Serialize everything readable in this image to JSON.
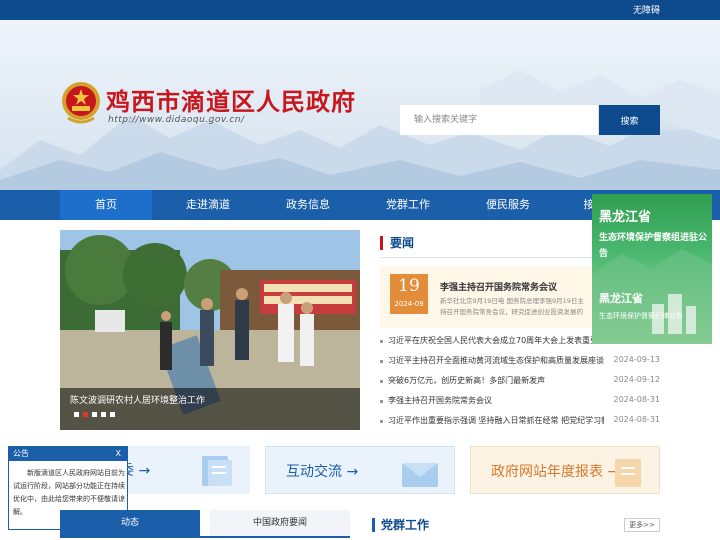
{
  "topbar": {
    "accessibility": "无障碍"
  },
  "header": {
    "title": "鸡西市滴道区人民政府",
    "url": "http://www.didaoqu.gov.cn/"
  },
  "search": {
    "placeholder": "输入搜索关键字",
    "button": "搜索"
  },
  "nav": {
    "items": [
      {
        "label": "首页"
      },
      {
        "label": "走进滴道"
      },
      {
        "label": "政务信息"
      },
      {
        "label": "党群工作"
      },
      {
        "label": "便民服务"
      },
      {
        "label": "接"
      }
    ]
  },
  "slider": {
    "caption": "陈文波调研农村人居环境整治工作"
  },
  "news": {
    "title": "要闻",
    "headline": {
      "day": "19",
      "ym": "2024-09",
      "title": "李强主持召开国务院常务会议",
      "summary": "新华社北京9月19日电  国务院总理李强9月19日主持召开国务院常务会议，研究促进创业投资发展的有关举措..."
    },
    "items": [
      {
        "text": "习近平在庆祝全国人民代表大会成立70周年大会上发表重要讲话",
        "date": ""
      },
      {
        "text": "习近平主持召开全面推动黄河流域生态保护和高质量发展座谈会",
        "date": "2024-09-13"
      },
      {
        "text": "突破6万亿元，创历史新高！多部门最新发声",
        "date": "2024-09-12"
      },
      {
        "text": "李强主持召开国务院常务会议",
        "date": "2024-08-31"
      },
      {
        "text": "习近平作出重要指示强调 坚持融入日常抓在经常 把党纪学习教育成果转化",
        "date": "2024-08-31"
      }
    ]
  },
  "ad": {
    "line1": "黑龙江省",
    "line2": "生态环境保护督察组进驻公告",
    "line3": "黑龙江省",
    "line4": "生态环境保护督察纪律公告"
  },
  "cards": [
    {
      "label": "委 →"
    },
    {
      "label": "互动交流 →"
    },
    {
      "label": "政府网站年度报表 →"
    }
  ],
  "notice": {
    "title": "公告",
    "close": "X",
    "body": "新版滴道区人民政府网站目前为试运行阶段，网站部分功能正在持续优化中，由此给您带来的不便敬请谅解。"
  },
  "tabs": {
    "tab1": "动态",
    "tab2": "中国政府要闻"
  },
  "party": {
    "title": "党群工作",
    "more": "更多>>"
  },
  "colors": {
    "brand_blue": "#1b5ea9",
    "title_red": "#c8161d",
    "date_orange": "#e38d3a"
  }
}
